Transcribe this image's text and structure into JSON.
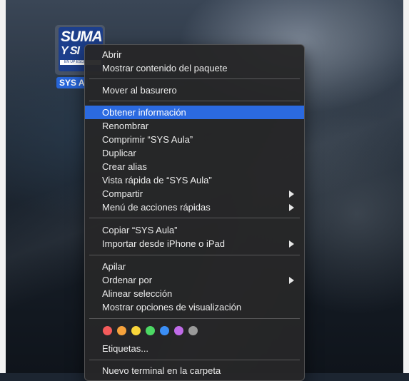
{
  "desktop_icon": {
    "label": "SYS A",
    "art_line1": "SUMA",
    "art_line2": "Y SI",
    "art_strip": "EN UP ESCU"
  },
  "context_menu": {
    "open": "Abrir",
    "show_package": "Mostrar contenido del paquete",
    "trash": "Mover al basurero",
    "get_info": "Obtener información",
    "rename": "Renombrar",
    "compress": "Comprimir “SYS Aula”",
    "duplicate": "Duplicar",
    "make_alias": "Crear alias",
    "quick_look": "Vista rápida de “SYS Aula”",
    "share": "Compartir",
    "quick_actions": "Menú de acciones rápidas",
    "copy": "Copiar “SYS Aula”",
    "import_iphone": "Importar desde iPhone o iPad",
    "stack": "Apilar",
    "sort_by": "Ordenar por",
    "align": "Alinear selección",
    "view_options": "Mostrar opciones de visualización",
    "tags_label": "Etiquetas...",
    "new_terminal": "Nuevo terminal en la carpeta",
    "highlighted": "Obtener información"
  },
  "tag_colors": [
    "#f45b5b",
    "#f6a23c",
    "#f8d53a",
    "#4cd964",
    "#3b8ff6",
    "#c06be8",
    "#9a9a9a"
  ],
  "icons": [
    "submenu-arrow-icon"
  ]
}
